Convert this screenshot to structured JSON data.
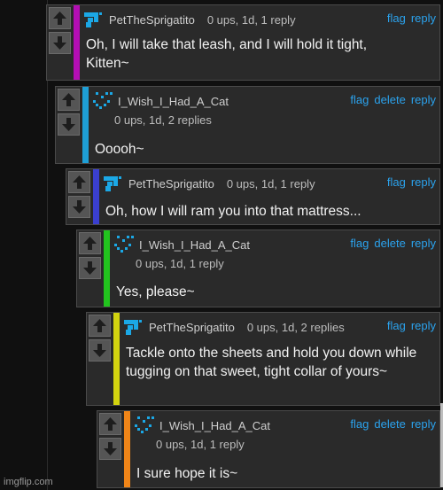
{
  "comments": [
    {
      "username": "PetTheSprigatito",
      "meta": "0 ups, 1d, 1 reply",
      "text": "Oh, I will take that leash, and I will hold it tight, Kitten~",
      "actions": [
        "flag",
        "reply"
      ],
      "bar_color": "#b40eb4",
      "avatar": "sprigatito-avatar"
    },
    {
      "username": "I_Wish_I_Had_A_Cat",
      "meta": "0 ups, 1d, 2 replies",
      "text": "Ooooh~",
      "actions": [
        "flag",
        "delete",
        "reply"
      ],
      "bar_color": "#1e9fd6",
      "avatar": "cat-avatar"
    },
    {
      "username": "PetTheSprigatito",
      "meta": "0 ups, 1d, 1 reply",
      "text": "Oh, how I will ram you into that mattress...",
      "actions": [
        "flag",
        "reply"
      ],
      "bar_color": "#3a3fcf",
      "avatar": "sprigatito-avatar"
    },
    {
      "username": "I_Wish_I_Had_A_Cat",
      "meta": "0 ups, 1d, 1 reply",
      "text": "Yes, please~",
      "actions": [
        "flag",
        "delete",
        "reply"
      ],
      "bar_color": "#22c41e",
      "avatar": "cat-avatar"
    },
    {
      "username": "PetTheSprigatito",
      "meta": "0 ups, 1d, 2 replies",
      "text": "Tackle onto the sheets and hold you down while tugging on that sweet, tight collar of yours~",
      "actions": [
        "flag",
        "reply"
      ],
      "bar_color": "#d3d40f",
      "avatar": "sprigatito-avatar"
    },
    {
      "username": "I_Wish_I_Had_A_Cat",
      "meta": "0 ups, 1d, 1 reply",
      "text": "I sure hope it is~",
      "actions": [
        "flag",
        "delete",
        "reply"
      ],
      "bar_color": "#f08518",
      "avatar": "cat-avatar"
    }
  ],
  "watermark": "imgflip.com"
}
